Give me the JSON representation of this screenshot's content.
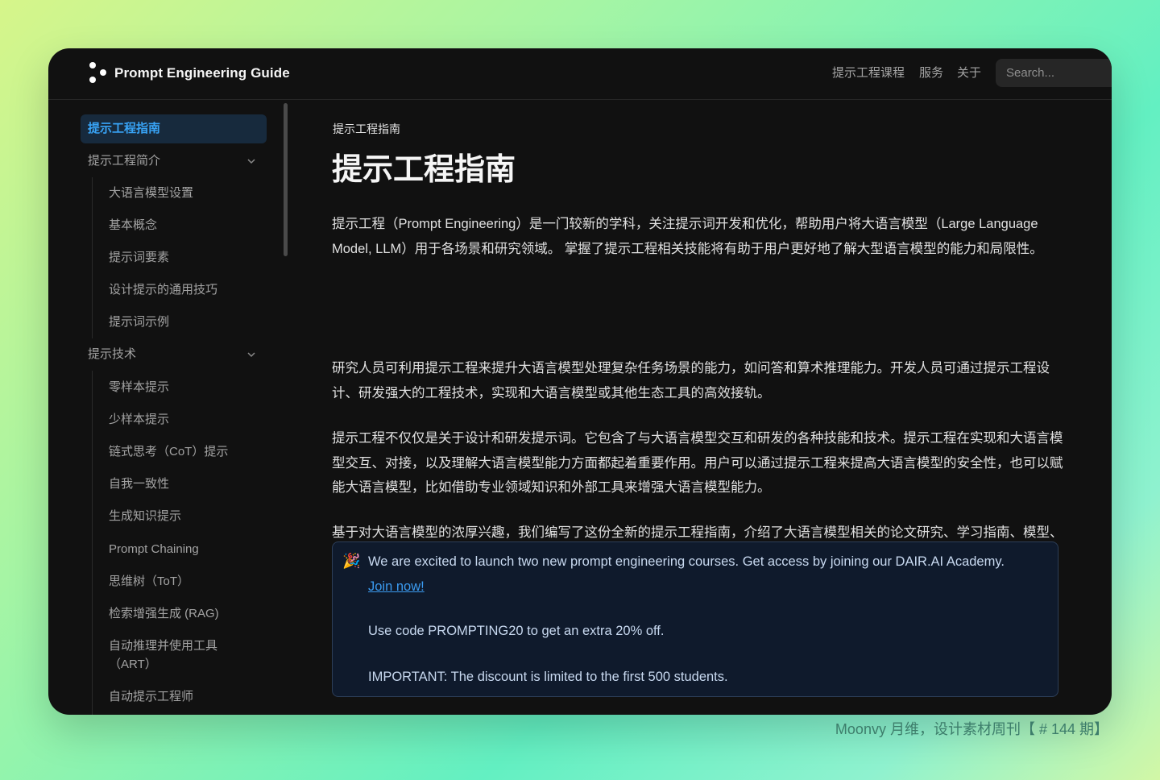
{
  "header": {
    "brand": "Prompt Engineering Guide",
    "nav": [
      "提示工程课程",
      "服务",
      "关于"
    ],
    "search_placeholder": "Search..."
  },
  "sidebar": {
    "active": "提示工程指南",
    "sections": [
      {
        "label": "提示工程简介",
        "items": [
          "大语言模型设置",
          "基本概念",
          "提示词要素",
          "设计提示的通用技巧",
          "提示词示例"
        ]
      },
      {
        "label": "提示技术",
        "items": [
          "零样本提示",
          "少样本提示",
          "链式思考（CoT）提示",
          "自我一致性",
          "生成知识提示",
          "Prompt Chaining",
          "思维树（ToT）",
          "检索增强生成 (RAG)",
          "自动推理并使用工具",
          "（ART）",
          "自动提示工程师"
        ]
      }
    ]
  },
  "main": {
    "breadcrumb": "提示工程指南",
    "title": "提示工程指南",
    "paragraphs": [
      "提示工程（Prompt Engineering）是一门较新的学科，关注提示词开发和优化，帮助用户将大语言模型（Large Language Model, LLM）用于各场景和研究领域。 掌握了提示工程相关技能将有助于用户更好地了解大型语言模型的能力和局限性。",
      "研究人员可利用提示工程来提升大语言模型处理复杂任务场景的能力，如问答和算术推理能力。开发人员可通过提示工程设计、研发强大的工程技术，实现和大语言模型或其他生态工具的高效接轨。",
      "提示工程不仅仅是关于设计和研发提示词。它包含了与大语言模型交互和研发的各种技能和技术。提示工程在实现和大语言模型交互、对接，以及理解大语言模型能力方面都起着重要作用。用户可以通过提示工程来提高大语言模型的安全性，也可以赋能大语言模型，比如借助专业领域知识和外部工具来增强大语言模型能力。",
      "基于对大语言模型的浓厚兴趣，我们编写了这份全新的提示工程指南，介绍了大语言模型相关的论文研究、学习指南、模型、讲座、参考资料、大语言模型能力以及与其他与提示工程相关的工具。"
    ],
    "callout": {
      "emoji": "🎉",
      "text": "We are excited to launch two new prompt engineering courses. Get access by joining our DAIR.AI Academy.",
      "link": "Join now!",
      "code_line": "Use code PROMPTING20 to get an extra 20% off.",
      "important_line": "IMPORTANT: The discount is limited to the first 500 students."
    }
  },
  "watermark": "Moonvy 月维，设计素材周刊【 # 144 期】",
  "colors": {
    "accent": "#38a3f5",
    "background": "#111111",
    "callout_border": "#2c3e58"
  }
}
